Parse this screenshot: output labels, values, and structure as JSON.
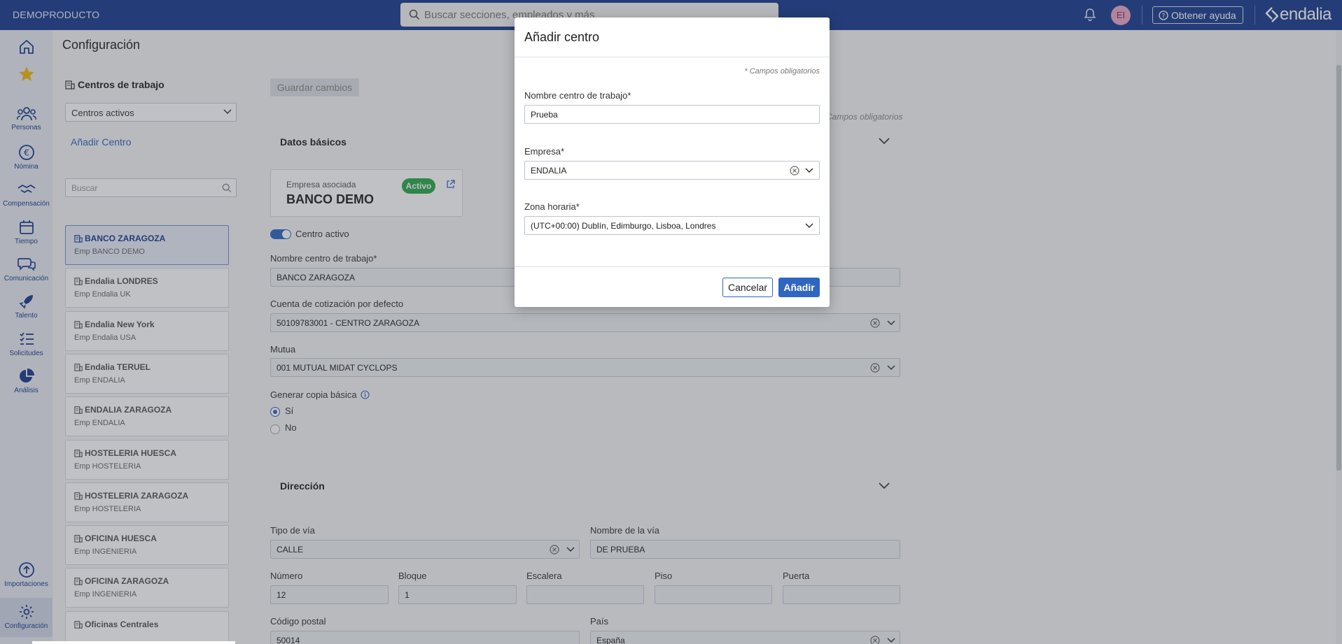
{
  "topbar": {
    "app_name": "DEMOPRODUCTO",
    "search_placeholder": "Buscar secciones, empleados y más",
    "avatar_initials": "EI",
    "help_label": "Obtener ayuda",
    "logo_text": "endalia",
    "bg_color": "#1a3d8f"
  },
  "nav": {
    "items": [
      {
        "label": "",
        "icon": "home-icon"
      },
      {
        "label": "",
        "icon": "star-icon"
      },
      {
        "label": "Personas",
        "icon": "people-icon"
      },
      {
        "label": "Nómina",
        "icon": "euro-icon"
      },
      {
        "label": "Compensación",
        "icon": "handshake-icon"
      },
      {
        "label": "Tiempo",
        "icon": "calendar-icon"
      },
      {
        "label": "Comunicación",
        "icon": "chat-icon"
      },
      {
        "label": "Talento",
        "icon": "rocket-icon"
      },
      {
        "label": "Solicitudes",
        "icon": "list-icon"
      },
      {
        "label": "Análisis",
        "icon": "pie-icon"
      },
      {
        "label": "Importaciones",
        "icon": "upload-icon"
      },
      {
        "label": "Configuración",
        "icon": "gear-icon"
      }
    ]
  },
  "page": {
    "title": "Configuración"
  },
  "centers_panel": {
    "title": "Centros de trabajo",
    "filter_value": "Centros activos",
    "add_link": "Añadir Centro",
    "search_placeholder": "Buscar",
    "items": [
      {
        "name": "BANCO ZARAGOZA",
        "company": "Emp BANCO DEMO"
      },
      {
        "name": "Endalia LONDRES",
        "company": "Emp Endalia UK"
      },
      {
        "name": "Endalia New York",
        "company": "Emp Endalia USA"
      },
      {
        "name": "Endalia TERUEL",
        "company": "Emp ENDALIA"
      },
      {
        "name": "ENDALIA ZARAGOZA",
        "company": "Emp ENDALIA"
      },
      {
        "name": "HOSTELERIA HUESCA",
        "company": "Emp HOSTELERIA"
      },
      {
        "name": "HOSTELERIA ZARAGOZA",
        "company": "Emp HOSTELERIA"
      },
      {
        "name": "OFICINA HUESCA",
        "company": "Emp INGENIERIA"
      },
      {
        "name": "OFICINA ZARAGOZA",
        "company": "Emp INGENIERIA"
      },
      {
        "name": "Oficinas Centrales",
        "company": ""
      }
    ]
  },
  "form": {
    "save_label": "Guardar cambios",
    "required_note": "Campos obligatorios",
    "datos_basicos": "Datos básicos",
    "empresa_label": "Empresa asociada",
    "empresa_value": "BANCO DEMO",
    "status_badge": "Activo",
    "active_toggle_label": "Centro activo",
    "center_name_label": "Nombre centro de trabajo*",
    "center_name_value": "BANCO ZARAGOZA",
    "cuenta_label": "Cuenta de cotización por defecto",
    "cuenta_value": "50109783001 - CENTRO ZARAGOZA",
    "mutua_label": "Mutua",
    "mutua_value": "001 MUTUAL MIDAT CYCLOPS",
    "copia_label": "Generar copia básica",
    "copia_yes": "Sí",
    "copia_no": "No",
    "direccion": "Dirección",
    "tipo_via_label": "Tipo de vía",
    "tipo_via_value": "CALLE",
    "nombre_via_label": "Nombre de la vía",
    "nombre_via_value": "DE PRUEBA",
    "numero_label": "Número",
    "numero_value": "12",
    "bloque_label": "Bloque",
    "bloque_value": "1",
    "escalera_label": "Escalera",
    "piso_label": "Piso",
    "puerta_label": "Puerta",
    "cp_label": "Código postal",
    "cp_value": "50014",
    "pais_label": "País",
    "pais_value": "España"
  },
  "modal": {
    "title": "Añadir centro",
    "required_note": "* Campos obligatorios",
    "name_label": "Nombre centro de trabajo*",
    "name_value": "Prueba",
    "company_label": "Empresa*",
    "company_value": "ENDALIA",
    "tz_label": "Zona horaria*",
    "tz_value": "(UTC+00:00) Dublín, Edimburgo, Lisboa, Londres",
    "cancel_label": "Cancelar",
    "add_label": "Añadir",
    "primary_color": "#2f66c1"
  }
}
